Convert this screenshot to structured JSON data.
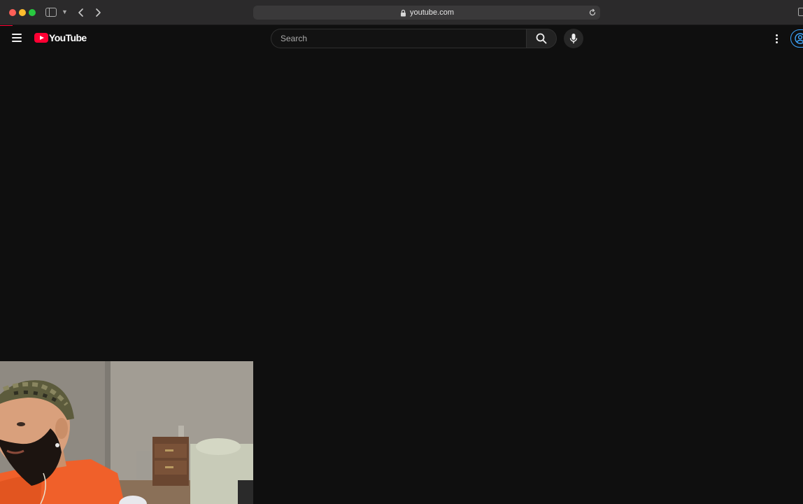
{
  "browser": {
    "address": "youtube.com",
    "icons": [
      "sidebar-toggle-icon",
      "chevron-down-icon",
      "back-arrow-icon",
      "forward-arrow-icon",
      "lock-icon",
      "reload-icon",
      "share-icon"
    ]
  },
  "youtube": {
    "logo_text": "YouTube",
    "search": {
      "placeholder": "Search",
      "value": ""
    },
    "icons": [
      "menu-icon",
      "youtube-play-icon",
      "search-icon",
      "mic-icon",
      "more-vertical-icon",
      "account-icon"
    ]
  },
  "colors": {
    "page_background": "#0f0f0f",
    "brand_red": "#ff0033",
    "sign_in_blue": "#3ea6ff",
    "browser_chrome": "#2b2a2b"
  }
}
